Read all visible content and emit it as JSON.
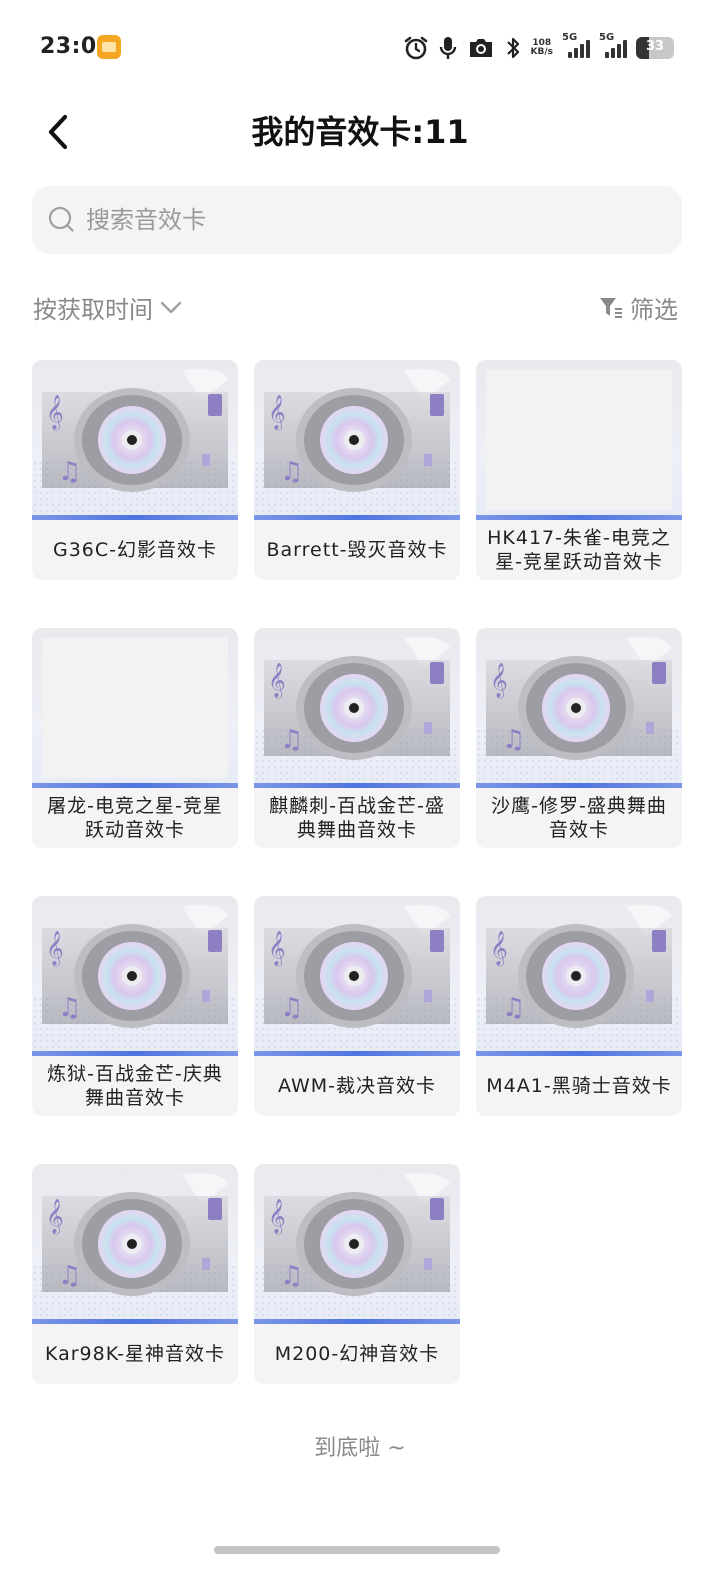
{
  "status_bar": {
    "time": "23:08",
    "net_speed_value": "108",
    "net_speed_unit": "KB/s",
    "sim1_label": "5G",
    "sim2_label": "5G",
    "battery_level": "33",
    "icons": [
      "alarm-icon",
      "microphone-icon",
      "camera-icon",
      "bluetooth-icon"
    ]
  },
  "header": {
    "title": "我的音效卡:11"
  },
  "search": {
    "placeholder": "搜索音效卡"
  },
  "toolbar": {
    "sort_label": "按获取时间",
    "filter_label": "筛选"
  },
  "cards": [
    {
      "label": "G36C-幻影音效卡",
      "image": "disc"
    },
    {
      "label": "Barrett-毁灭音效卡",
      "image": "disc"
    },
    {
      "label": "HK417-朱雀-电竞之星-竞星跃动音效卡",
      "image": "blank"
    },
    {
      "label": "屠龙-电竞之星-竞星跃动音效卡",
      "image": "blank"
    },
    {
      "label": "麒麟刺-百战金芒-盛典舞曲音效卡",
      "image": "disc"
    },
    {
      "label": "沙鹰-修罗-盛典舞曲音效卡",
      "image": "disc"
    },
    {
      "label": "炼狱-百战金芒-庆典舞曲音效卡",
      "image": "disc"
    },
    {
      "label": "AWM-裁决音效卡",
      "image": "disc"
    },
    {
      "label": "M4A1-黑骑士音效卡",
      "image": "disc"
    },
    {
      "label": "Kar98K-星神音效卡",
      "image": "disc"
    },
    {
      "label": "M200-幻神音效卡",
      "image": "disc"
    }
  ],
  "footer": {
    "end_text": "到底啦 ~"
  },
  "colors": {
    "accent_bar": "#4f74e0",
    "card_bg": "#f4f4f6",
    "muted_text": "#8a8a8e"
  }
}
